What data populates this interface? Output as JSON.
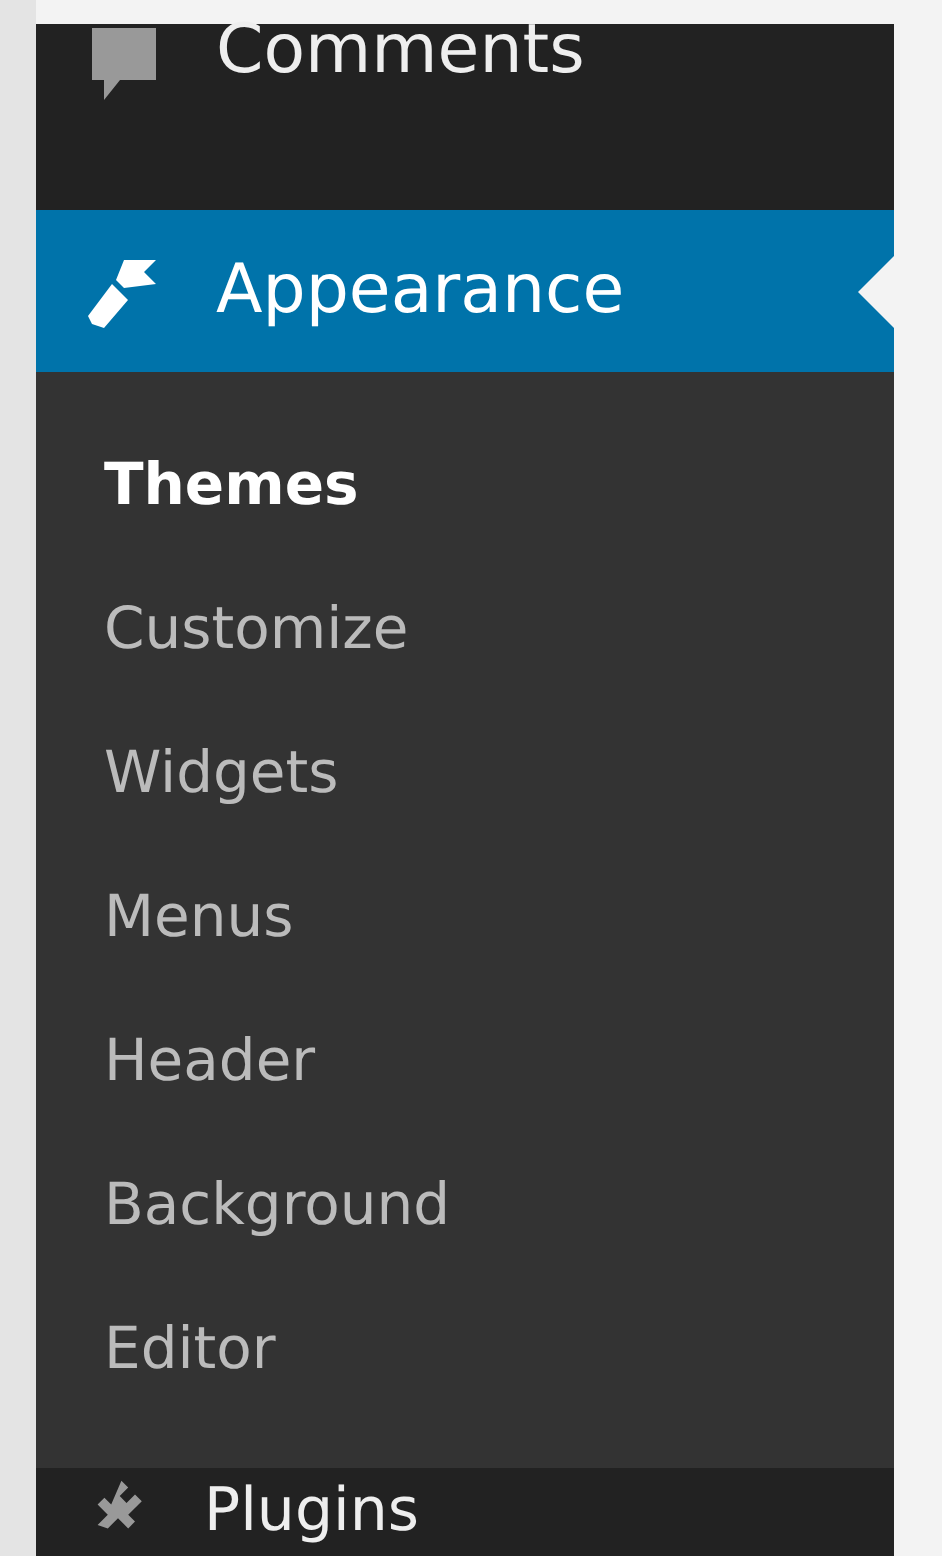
{
  "menu": [
    {
      "label": "Comments",
      "kind": "comment",
      "selected": false
    },
    {
      "label": "Appearance",
      "kind": "brush",
      "selected": true,
      "submenu": [
        {
          "label": "Themes",
          "selected": true
        },
        {
          "label": "Customize",
          "selected": false
        },
        {
          "label": "Widgets",
          "selected": false
        },
        {
          "label": "Menus",
          "selected": false
        },
        {
          "label": "Header",
          "selected": false
        },
        {
          "label": "Background",
          "selected": false
        },
        {
          "label": "Editor",
          "selected": false
        }
      ]
    },
    {
      "label": "Plugins",
      "kind": "plug",
      "selected": false
    }
  ]
}
